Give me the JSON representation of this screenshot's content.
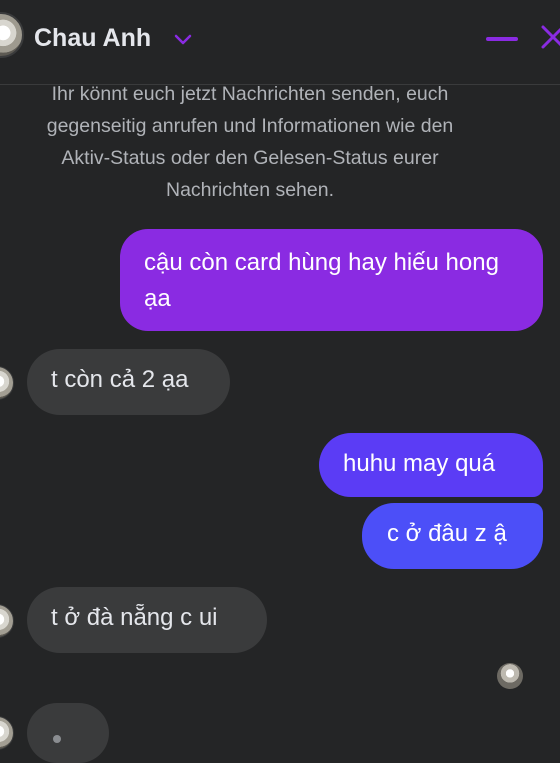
{
  "header": {
    "contact_name": "Chau Anh",
    "accent_color": "#8a2be2",
    "icons": [
      "contact-avatar",
      "chevron-down-icon",
      "minimize-icon",
      "close-icon"
    ]
  },
  "chat": {
    "intro_lines": [
      "Ihr könnt euch jetzt Nachrichten senden, euch",
      "gegenseitig anrufen und Informationen wie den",
      "Aktiv-Status oder den Gelesen-Status eurer",
      "Nachrichten sehen."
    ],
    "messages": [
      {
        "from": "me",
        "text": "cậu còn card hùng hay hiếu hong ạa"
      },
      {
        "from": "them",
        "text": "t còn cả 2 ạa"
      },
      {
        "from": "me",
        "text": "huhu may quá"
      },
      {
        "from": "me",
        "text": "c ở đâu z ậ"
      },
      {
        "from": "them",
        "text": "t ở đà nẵng c ui"
      }
    ],
    "typing_indicator": "…"
  }
}
